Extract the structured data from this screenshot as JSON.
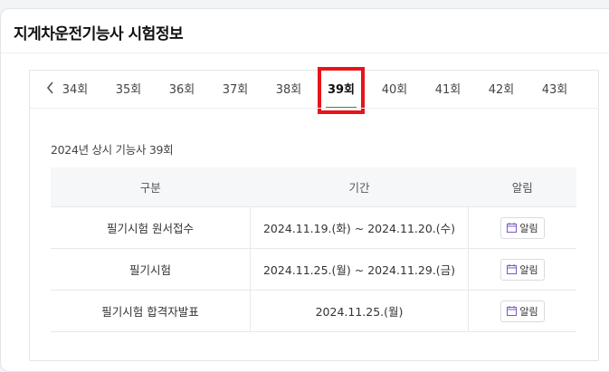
{
  "card": {
    "title": "지게차운전기능사 시험정보"
  },
  "tabs": {
    "items": [
      "34회",
      "35회",
      "36회",
      "37회",
      "38회",
      "39회",
      "40회",
      "41회",
      "42회",
      "43회"
    ],
    "active_index": 5
  },
  "section": {
    "label": "2024년 상시 기능사 39회"
  },
  "table": {
    "headers": [
      "구분",
      "기간",
      "알림"
    ],
    "rows": [
      {
        "category": "필기시험 원서접수",
        "period": "2024.11.19.(화) ~ 2024.11.20.(수)",
        "alarm_label": "알림"
      },
      {
        "category": "필기시험",
        "period": "2024.11.25.(월) ~ 2024.11.29.(금)",
        "alarm_label": "알림"
      },
      {
        "category": "필기시험 합격자발표",
        "period": "2024.11.25.(월)",
        "alarm_label": "알림"
      }
    ]
  },
  "colors": {
    "active_underline": "#2e9b40",
    "highlight_box": "#e8141b",
    "calendar_icon": "#7a58c8"
  }
}
